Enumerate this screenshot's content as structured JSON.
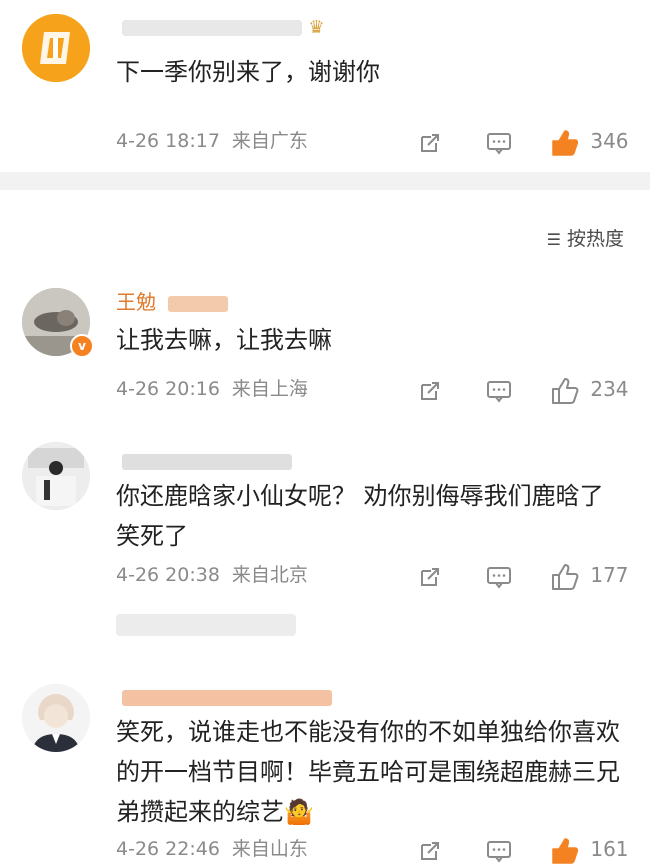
{
  "sort_label": "按热度",
  "comments": [
    {
      "name": "",
      "text": "下一季你别来了，谢谢你",
      "date": "4-26 18:17",
      "location": "来自广东",
      "likes": "346",
      "liked": true
    },
    {
      "name": "王勉",
      "text": "让我去嘛，让我去嘛",
      "date": "4-26 20:16",
      "location": "来自上海",
      "likes": "234",
      "liked": false
    },
    {
      "name": "",
      "text": "你还鹿晗家小仙女呢？ 劝你别侮辱我们鹿晗了 笑死了",
      "date": "4-26 20:38",
      "location": "来自北京",
      "likes": "177",
      "liked": false
    },
    {
      "name": "",
      "text": "笑死，说谁走也不能没有你的不如单独给你喜欢的开一档节目啊！毕竟五哈可是围绕超鹿赫三兄弟攒起来的综艺🤷",
      "date": "4-26 22:46",
      "location": "来自山东",
      "likes": "161",
      "liked": true
    }
  ],
  "colors": {
    "username": "#e07a2c",
    "like_active": "#f58220",
    "meta": "#8a8a8a"
  }
}
